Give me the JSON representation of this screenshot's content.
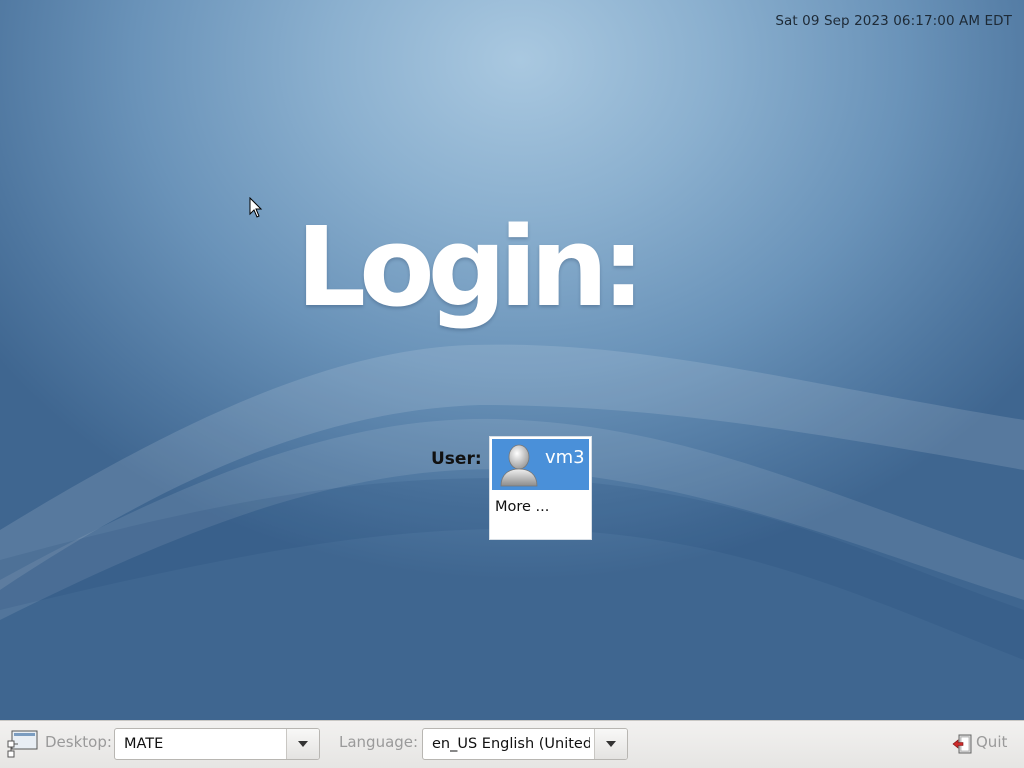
{
  "clock": {
    "datetime": "Sat 09 Sep 2023 06:17:00 AM EDT"
  },
  "login": {
    "title": "Login:",
    "user_label": "User:",
    "users": [
      {
        "name": "vm3",
        "selected": true
      }
    ],
    "more_label": "More ..."
  },
  "bottom_bar": {
    "desktop_label": "Desktop:",
    "desktop_value": "MATE",
    "language_label": "Language:",
    "language_value": "en_US  English (United S",
    "quit_label": "Quit"
  },
  "icons": {
    "desktop": "desktop-session-icon",
    "quit": "quit-door-icon",
    "avatar": "user-avatar-icon",
    "cursor": "mouse-pointer-icon"
  },
  "colors": {
    "selection": "#4a90d9",
    "background_center": "#a9c8e0",
    "background_edge": "#3f6690",
    "bar": "#f2f1f0"
  }
}
